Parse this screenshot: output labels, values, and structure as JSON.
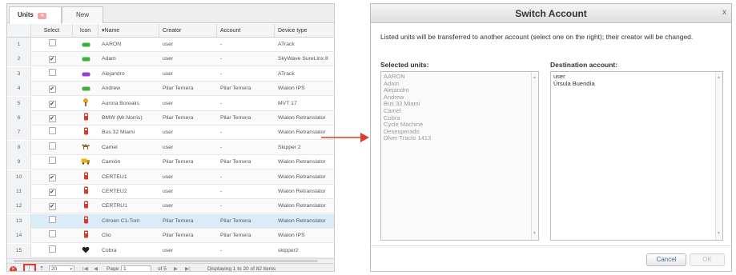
{
  "units_panel": {
    "tabs": [
      {
        "label": "Units",
        "active": true,
        "close_label": "✕"
      },
      {
        "label": "New",
        "active": false
      }
    ],
    "columns": [
      "",
      "Select",
      "Icon",
      "▾Name",
      "Creator",
      "Account",
      "Device type"
    ],
    "rows": [
      {
        "num": "1",
        "checked": false,
        "icon": "green-car-icon",
        "name": "AARON",
        "creator": "user",
        "account": "-",
        "device": "ATrack"
      },
      {
        "num": "2",
        "checked": true,
        "icon": "green-car-icon",
        "name": "Adam",
        "creator": "user",
        "account": "-",
        "device": "SkyWave SureLinx 8"
      },
      {
        "num": "3",
        "checked": false,
        "icon": "purple-car-icon",
        "name": "Alejandro",
        "creator": "user",
        "account": "-",
        "device": "ATrack"
      },
      {
        "num": "4",
        "checked": true,
        "icon": "green-car-icon",
        "name": "Andrew",
        "creator": "Pilar Ternera",
        "account": "Pilar Ternera",
        "device": "Wialon IPS"
      },
      {
        "num": "5",
        "checked": true,
        "icon": "torch-icon",
        "name": "Aurora Borealis",
        "creator": "user",
        "account": "-",
        "device": "MVT 17"
      },
      {
        "num": "6",
        "checked": true,
        "icon": "red-bus-icon",
        "name": "BMW (Mr.Norris)",
        "creator": "Pilar Ternera",
        "account": "Pilar Ternera",
        "device": "Wialon Retranslator"
      },
      {
        "num": "7",
        "checked": false,
        "icon": "red-bus-icon",
        "name": "Bus 32 Miami",
        "creator": "user",
        "account": "-",
        "device": "Wialon Retranslator"
      },
      {
        "num": "8",
        "checked": false,
        "icon": "camel-icon",
        "name": "Camel",
        "creator": "user",
        "account": "-",
        "device": "Skipper 2"
      },
      {
        "num": "9",
        "checked": false,
        "icon": "truck-icon",
        "name": "Camión",
        "creator": "Pilar Ternera",
        "account": "Pilar Ternera",
        "device": "Wialon Retranslator"
      },
      {
        "num": "10",
        "checked": true,
        "icon": "red-bus-icon",
        "name": "CERTEU1",
        "creator": "user",
        "account": "-",
        "device": "Wialon Retranslator"
      },
      {
        "num": "11",
        "checked": true,
        "icon": "red-bus-icon",
        "name": "CERTEU2",
        "creator": "user",
        "account": "-",
        "device": "Wialon Retranslator"
      },
      {
        "num": "12",
        "checked": true,
        "icon": "red-bus-icon",
        "name": "CERTRU1",
        "creator": "user",
        "account": "-",
        "device": "Wialon Retranslator"
      },
      {
        "num": "13",
        "checked": false,
        "icon": "red-bus-icon",
        "name": "Citroen C1-Tom",
        "creator": "Pilar Ternera",
        "account": "Pilar Ternera",
        "device": "Wialon Retranslator",
        "highlighted": true
      },
      {
        "num": "14",
        "checked": false,
        "icon": "red-bus-icon",
        "name": "Clio",
        "creator": "Pilar Ternera",
        "account": "Pilar Ternera",
        "device": "Wialon IPS"
      },
      {
        "num": "15",
        "checked": false,
        "icon": "heart-icon",
        "name": "Cobra",
        "creator": "user",
        "account": "-",
        "device": "skipper2"
      }
    ],
    "pager": {
      "per_page": "20",
      "page_label": "Page",
      "page": "1",
      "of_label": "of 5",
      "status": "Displaying 1 to 20 of 82 items"
    }
  },
  "dialog": {
    "title": "Switch Account",
    "description": "Listed units will be transferred to another account (select one on the right); their creator will be changed.",
    "selected_label": "Selected units:",
    "selected_units": [
      "AARON",
      "Adam",
      "Alejandro",
      "Andrew",
      "Bus 32 Miami",
      "Camel",
      "Cobra",
      "Cycle Machine",
      "Desesperado",
      "Dlver Tracto 1413"
    ],
    "destination_label": "Destination account:",
    "destination_accounts": [
      "user",
      "Úrsula Buendía"
    ],
    "cancel_label": "Cancel",
    "ok_label": "OK",
    "close_label": "x"
  },
  "colors": {
    "highlight_red": "#e03b2c",
    "selected_row": "#dbecf9",
    "link_blue": "#3a6ea5"
  }
}
